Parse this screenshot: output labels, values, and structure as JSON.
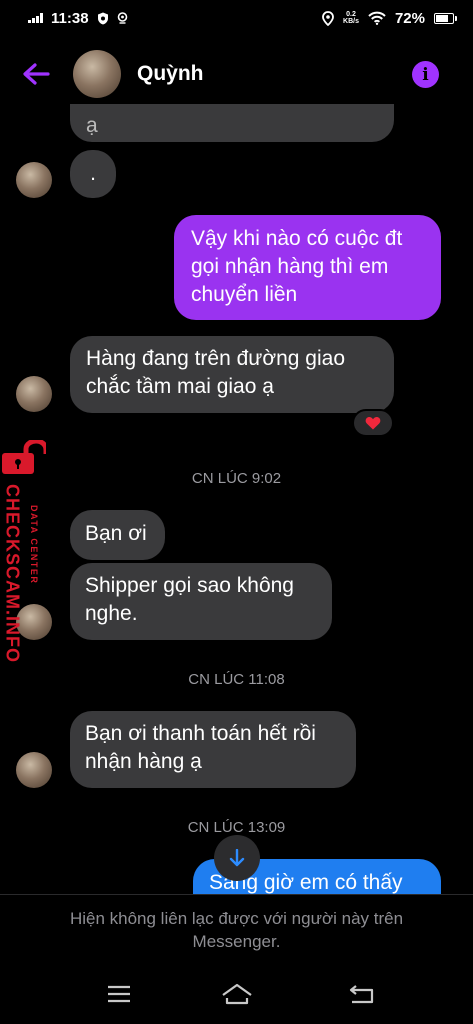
{
  "status_bar": {
    "time": "11:38",
    "network_speed_value": "0.2",
    "network_speed_unit": "KB/s",
    "battery_percent": "72%",
    "battery_level": 0.72
  },
  "header": {
    "contact_name": "Quỳnh"
  },
  "messages": {
    "m1": ".",
    "m2": "Vậy khi nào có cuộc đt gọi nhận hàng thì em chuyển liền",
    "m3": "Hàng đang trên đường giao chắc tầm mai giao ạ",
    "m3_reaction": "heart",
    "t1": "CN LÚC 9:02",
    "m4": "Bạn ơi",
    "m5": "Shipper gọi sao không nghe.",
    "t2": "CN LÚC 11:08",
    "m6": "Bạn ơi thanh toán hết rồi nhận hàng ạ",
    "t3": "CN LÚC 13:09",
    "m7": "Sang giờ em có thấy"
  },
  "partial_top": "ạ",
  "watermark": {
    "main": "CHECKSCAM.INFO",
    "sub": "DATA CENTER"
  },
  "footer": {
    "notice": "Hiện không liên lạc được với người này trên Messenger."
  },
  "colors": {
    "accent": "#9a33f0",
    "incoming_bubble": "#3a3a3c",
    "watermark": "#d9192b"
  }
}
